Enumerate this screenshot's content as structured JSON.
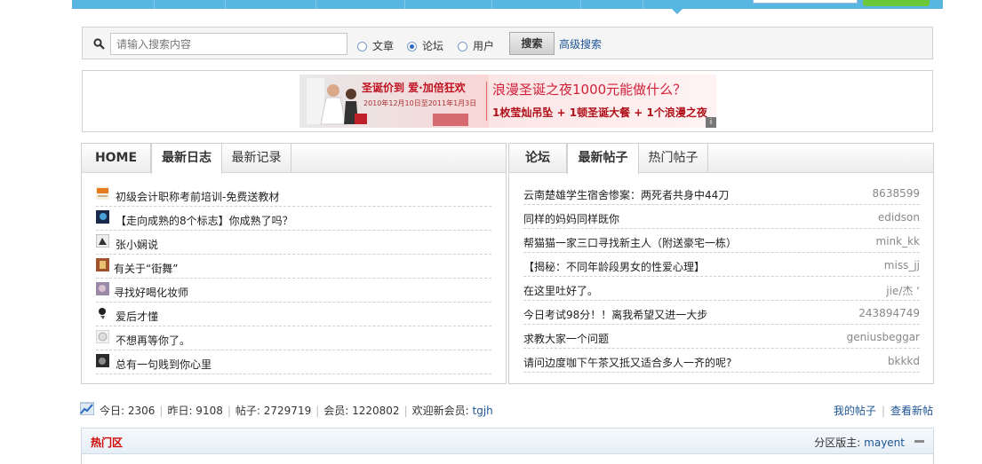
{
  "search": {
    "placeholder": "请输入搜索内容",
    "options": [
      "文章",
      "论坛",
      "用户"
    ],
    "selected": "论坛",
    "button_label": "搜索",
    "advanced_label": "高级搜索"
  },
  "ad": {
    "title": "圣诞价到 爱·加倍狂欢",
    "date": "2010年12月10日至2011年1月3日",
    "headline": "浪漫圣诞之夜1000元能做什么？",
    "sub": "1枚莹灿吊坠 + 1顿圣诞大餐 + 1个浪漫之夜"
  },
  "left_panel": {
    "tabs": [
      "HOME",
      "最新日志",
      "最新记录"
    ],
    "items": [
      "初级会计职称考前培训-免费送教材",
      "【走向成熟的8个标志】你成熟了吗？",
      "张小娴说",
      "有关于“街舞”",
      "寻找好喝化妆师",
      "爱后才懂",
      "不想再等你了。",
      "总有一句贱到你心里"
    ]
  },
  "right_panel": {
    "tabs": [
      "论坛",
      "最新帖子",
      "热门帖子"
    ],
    "items": [
      {
        "title": "云南楚雄学生宿舍惨案：两死者共身中44刀",
        "author": "8638599"
      },
      {
        "title": "同样的妈妈同样既你",
        "author": "edidson"
      },
      {
        "title": "帮猫猫一家三口寻找新主人（附送豪宅一栋）",
        "author": "mink_kk"
      },
      {
        "title": "【揭秘：不同年龄段男女的性爱心理】",
        "author": "miss_jj"
      },
      {
        "title": "在这里吐好了。",
        "author": "jie/杰 ‘"
      },
      {
        "title": "今日考试98分！！离我希望又进一大步",
        "author": "243894749"
      },
      {
        "title": "求教大家一个问题",
        "author": "geniusbeggar"
      },
      {
        "title": "请问边度咖下午茶又抵又适合多人一齐的呢?",
        "author": "bkkkd"
      }
    ]
  },
  "stats": {
    "today": "今日: 2306",
    "yesterday": "昨日: 9108",
    "posts": "帖子: 2729719",
    "members": "会员: 1220802",
    "welcome": "欢迎新会员:",
    "new_member": "tgjh",
    "my_posts": "我的帖子",
    "view_new": "查看新帖"
  },
  "hot": {
    "title": "热门区",
    "moderator_label": "分区版主:",
    "moderator": "mayent"
  }
}
